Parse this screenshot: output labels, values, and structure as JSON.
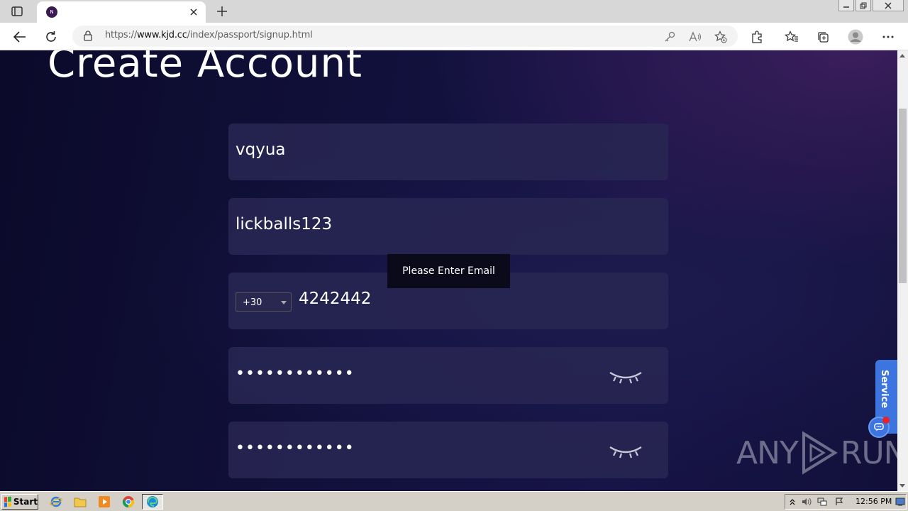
{
  "browser": {
    "tab_title": "",
    "url_prefix": "https://",
    "url_host": "www.kjd.cc",
    "url_path": "/index/passport/signup.html"
  },
  "page": {
    "title": "Create Account",
    "username_value": "vqyua",
    "second_value": "lickballs123",
    "country_code": "+30",
    "phone_value": "4242442",
    "password_masked": "••••••••••••",
    "confirm_password_masked": "••••••••••••",
    "toast_message": "Please Enter Email",
    "service_label": "Service",
    "watermark_left": "ANY",
    "watermark_right": "RUN"
  },
  "taskbar": {
    "start_label": "Start",
    "clock": "12:56 PM"
  },
  "colors": {
    "accent_service": "#3c74e0",
    "page_bg": "#12113d",
    "field_bg": "#282652"
  }
}
